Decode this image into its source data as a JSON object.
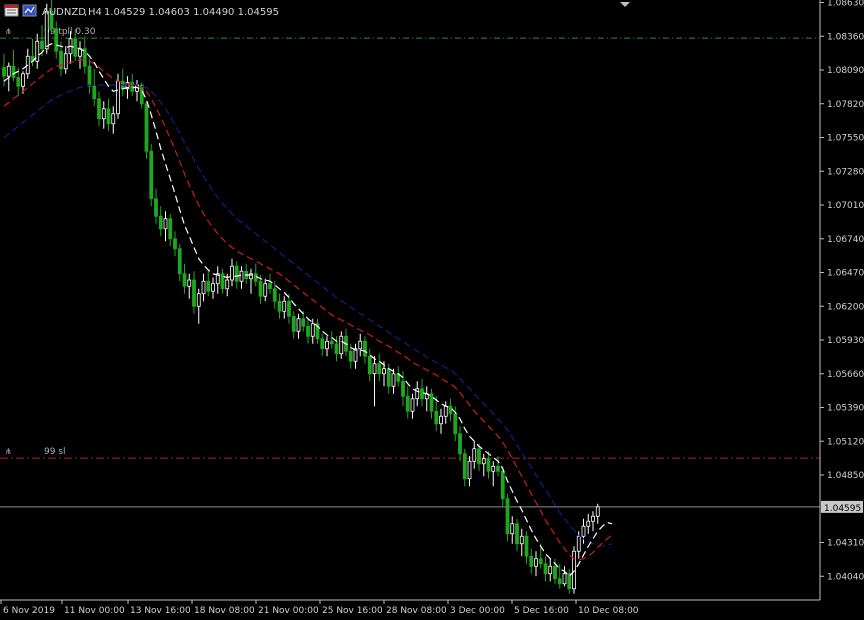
{
  "header": {
    "symbol": "AUDNZD",
    "timeframe": "H4",
    "ohlc_text": "1.04529 1.04603 1.04490 1.04595"
  },
  "colors": {
    "background": "#000000",
    "axis": "#c0c0c0",
    "text": "#d0d0d0",
    "bull_candle": "#ffffff",
    "bear_candle": "#1fa71f",
    "ma_fast": "#ffffff",
    "ma_mid": "#d01a1a",
    "ma_slow": "#1a1a8c",
    "tp_line": "#2e8b2e",
    "sl_line": "#c01a1a",
    "price_line": "#8a9099",
    "price_label_bg": "#c8c8c8",
    "price_label_text": "#000000"
  },
  "chart_data": {
    "type": "candlestick",
    "symbol": "AUDNZD",
    "timeframe": "H4",
    "ylim": [
      1.0385,
      1.0865
    ],
    "y_ticks": [
      "1.08630",
      "1.08360",
      "1.08090",
      "1.07820",
      "1.07550",
      "1.07280",
      "1.07010",
      "1.06740",
      "1.06470",
      "1.06200",
      "1.05930",
      "1.05660",
      "1.05390",
      "1.05120",
      "1.04850",
      "1.04310",
      "1.04040"
    ],
    "x_ticks": [
      "6 Nov 2019",
      "11 Nov 00:00",
      "13 Nov 16:00",
      "18 Nov 08:00",
      "21 Nov 00:00",
      "25 Nov 16:00",
      "28 Nov 08:00",
      "3 Dec 00:00",
      "5 Dec 16:00",
      "10 Dec 08:00"
    ],
    "current_price": 1.04595,
    "current_price_label": "1.04595",
    "levels": [
      {
        "label": "99 tpll 0.30",
        "price": 1.08345,
        "kind": "tp"
      },
      {
        "label": "99 sl",
        "price": 1.04985,
        "kind": "sl"
      }
    ],
    "candles": [
      [
        1.0811,
        1.0822,
        1.0796,
        1.0804
      ],
      [
        1.0804,
        1.0815,
        1.0792,
        1.0812
      ],
      [
        1.0812,
        1.0825,
        1.08,
        1.0803
      ],
      [
        1.0803,
        1.0811,
        1.0788,
        1.0796
      ],
      [
        1.0796,
        1.0808,
        1.079,
        1.0806
      ],
      [
        1.0806,
        1.0826,
        1.0802,
        1.082
      ],
      [
        1.082,
        1.0834,
        1.0812,
        1.0816
      ],
      [
        1.0816,
        1.0838,
        1.081,
        1.0832
      ],
      [
        1.0832,
        1.0845,
        1.082,
        1.0826
      ],
      [
        1.0826,
        1.0862,
        1.0822,
        1.0856
      ],
      [
        1.0856,
        1.0866,
        1.0838,
        1.0842
      ],
      [
        1.0842,
        1.0848,
        1.0818,
        1.0824
      ],
      [
        1.0824,
        1.0832,
        1.0804,
        1.081
      ],
      [
        1.081,
        1.0828,
        1.0806,
        1.0822
      ],
      [
        1.0822,
        1.084,
        1.0814,
        1.0834
      ],
      [
        1.0834,
        1.0842,
        1.0816,
        1.082
      ],
      [
        1.082,
        1.0832,
        1.081,
        1.0826
      ],
      [
        1.0826,
        1.0836,
        1.0806,
        1.0812
      ],
      [
        1.0812,
        1.0818,
        1.079,
        1.0796
      ],
      [
        1.0796,
        1.081,
        1.078,
        1.0786
      ],
      [
        1.0786,
        1.0792,
        1.0764,
        1.077
      ],
      [
        1.077,
        1.0784,
        1.0762,
        1.0778
      ],
      [
        1.0778,
        1.0786,
        1.076,
        1.0766
      ],
      [
        1.0766,
        1.078,
        1.0758,
        1.0774
      ],
      [
        1.0774,
        1.0806,
        1.077,
        1.08
      ],
      [
        1.08,
        1.081,
        1.0788,
        1.0794
      ],
      [
        1.0794,
        1.0804,
        1.0786,
        1.0799
      ],
      [
        1.0799,
        1.0806,
        1.0788,
        1.0792
      ],
      [
        1.0792,
        1.0801,
        1.0784,
        1.0797
      ],
      [
        1.0797,
        1.0799,
        1.0778,
        1.0782
      ],
      [
        1.0782,
        1.0784,
        1.0738,
        1.0744
      ],
      [
        1.0744,
        1.075,
        1.07,
        1.0706
      ],
      [
        1.0706,
        1.0714,
        1.0686,
        1.0692
      ],
      [
        1.0692,
        1.07,
        1.0676,
        1.0682
      ],
      [
        1.0682,
        1.0696,
        1.0672,
        1.069
      ],
      [
        1.069,
        1.0694,
        1.0668,
        1.0674
      ],
      [
        1.0674,
        1.068,
        1.066,
        1.0666
      ],
      [
        1.0666,
        1.067,
        1.064,
        1.0646
      ],
      [
        1.0646,
        1.0654,
        1.063,
        1.0636
      ],
      [
        1.0636,
        1.0646,
        1.0626,
        1.0641
      ],
      [
        1.0641,
        1.0648,
        1.0614,
        1.062
      ],
      [
        1.062,
        1.0634,
        1.0606,
        1.063
      ],
      [
        1.063,
        1.0646,
        1.0624,
        1.064
      ],
      [
        1.064,
        1.0648,
        1.0628,
        1.0632
      ],
      [
        1.0632,
        1.0643,
        1.0626,
        1.0638
      ],
      [
        1.0638,
        1.0652,
        1.063,
        1.0646
      ],
      [
        1.0646,
        1.065,
        1.063,
        1.0634
      ],
      [
        1.0634,
        1.0646,
        1.0628,
        1.0641
      ],
      [
        1.0641,
        1.0658,
        1.0636,
        1.0652
      ],
      [
        1.0652,
        1.0656,
        1.0634,
        1.064
      ],
      [
        1.064,
        1.0652,
        1.0634,
        1.0648
      ],
      [
        1.0648,
        1.0654,
        1.0638,
        1.0642
      ],
      [
        1.0642,
        1.065,
        1.063,
        1.0646
      ],
      [
        1.0646,
        1.0654,
        1.0636,
        1.064
      ],
      [
        1.064,
        1.0645,
        1.0622,
        1.0628
      ],
      [
        1.0628,
        1.0642,
        1.0624,
        1.0638
      ],
      [
        1.0638,
        1.0646,
        1.063,
        1.0634
      ],
      [
        1.0634,
        1.064,
        1.0618,
        1.0624
      ],
      [
        1.0624,
        1.063,
        1.061,
        1.0616
      ],
      [
        1.0616,
        1.0628,
        1.061,
        1.0624
      ],
      [
        1.0624,
        1.063,
        1.0606,
        1.0612
      ],
      [
        1.0612,
        1.0616,
        1.0594,
        1.06
      ],
      [
        1.06,
        1.0614,
        1.0594,
        1.061
      ],
      [
        1.061,
        1.0616,
        1.06,
        1.0604
      ],
      [
        1.0604,
        1.061,
        1.059,
        1.0596
      ],
      [
        1.0596,
        1.061,
        1.059,
        1.0606
      ],
      [
        1.0606,
        1.061,
        1.059,
        1.0594
      ],
      [
        1.0594,
        1.0598,
        1.058,
        1.0586
      ],
      [
        1.0586,
        1.0596,
        1.058,
        1.0592
      ],
      [
        1.0592,
        1.06,
        1.0586,
        1.059
      ],
      [
        1.059,
        1.0596,
        1.0576,
        1.0582
      ],
      [
        1.0582,
        1.06,
        1.0578,
        1.0596
      ],
      [
        1.0596,
        1.0602,
        1.058,
        1.0584
      ],
      [
        1.0584,
        1.059,
        1.057,
        1.0576
      ],
      [
        1.0576,
        1.059,
        1.057,
        1.0586
      ],
      [
        1.0586,
        1.0598,
        1.058,
        1.0592
      ],
      [
        1.0592,
        1.0596,
        1.0574,
        1.058
      ],
      [
        1.058,
        1.0586,
        1.056,
        1.0566
      ],
      [
        1.0566,
        1.058,
        1.054,
        1.0574
      ],
      [
        1.0574,
        1.0582,
        1.056,
        1.0566
      ],
      [
        1.0566,
        1.0576,
        1.0556,
        1.057
      ],
      [
        1.057,
        1.0574,
        1.055,
        1.0556
      ],
      [
        1.0556,
        1.057,
        1.055,
        1.0566
      ],
      [
        1.0566,
        1.0572,
        1.0556,
        1.056
      ],
      [
        1.056,
        1.0568,
        1.054,
        1.0548
      ],
      [
        1.0548,
        1.0556,
        1.053,
        1.0536
      ],
      [
        1.0536,
        1.055,
        1.053,
        1.0546
      ],
      [
        1.0546,
        1.056,
        1.054,
        1.0554
      ],
      [
        1.0554,
        1.0562,
        1.054,
        1.0546
      ],
      [
        1.0546,
        1.0556,
        1.0536,
        1.055
      ],
      [
        1.055,
        1.0554,
        1.053,
        1.0536
      ],
      [
        1.0536,
        1.0548,
        1.052,
        1.0526
      ],
      [
        1.0526,
        1.0538,
        1.0518,
        1.0532
      ],
      [
        1.0532,
        1.0544,
        1.0526,
        1.054
      ],
      [
        1.054,
        1.0546,
        1.0528,
        1.0534
      ],
      [
        1.0534,
        1.054,
        1.0512,
        1.0518
      ],
      [
        1.0518,
        1.0524,
        1.0496,
        1.0502
      ],
      [
        1.0502,
        1.0506,
        1.0476,
        1.0482
      ],
      [
        1.0482,
        1.05,
        1.0476,
        1.0496
      ],
      [
        1.0496,
        1.0512,
        1.049,
        1.0506
      ],
      [
        1.0506,
        1.051,
        1.0488,
        1.0494
      ],
      [
        1.0494,
        1.0502,
        1.0484,
        1.0498
      ],
      [
        1.0498,
        1.0504,
        1.0482,
        1.0488
      ],
      [
        1.0488,
        1.0496,
        1.0476,
        1.0492
      ],
      [
        1.0492,
        1.05,
        1.0484,
        1.0488
      ],
      [
        1.0488,
        1.0492,
        1.046,
        1.0466
      ],
      [
        1.0466,
        1.047,
        1.0432,
        1.0438
      ],
      [
        1.0438,
        1.0452,
        1.043,
        1.0446
      ],
      [
        1.0446,
        1.045,
        1.0424,
        1.043
      ],
      [
        1.043,
        1.0442,
        1.042,
        1.0436
      ],
      [
        1.0436,
        1.044,
        1.0414,
        1.042
      ],
      [
        1.042,
        1.0426,
        1.0406,
        1.0412
      ],
      [
        1.0412,
        1.0424,
        1.0404,
        1.0418
      ],
      [
        1.0418,
        1.043,
        1.041,
        1.0414
      ],
      [
        1.0414,
        1.042,
        1.04,
        1.0406
      ],
      [
        1.0406,
        1.0418,
        1.04,
        1.0412
      ],
      [
        1.0412,
        1.0418,
        1.0398,
        1.0402
      ],
      [
        1.0402,
        1.0414,
        1.0394,
        1.0398
      ],
      [
        1.0398,
        1.0412,
        1.0396,
        1.0406
      ],
      [
        1.0406,
        1.041,
        1.039,
        1.0394
      ],
      [
        1.0394,
        1.0428,
        1.039,
        1.0424
      ],
      [
        1.0424,
        1.044,
        1.0418,
        1.0436
      ],
      [
        1.0436,
        1.045,
        1.043,
        1.0444
      ],
      [
        1.0444,
        1.0454,
        1.0438,
        1.0448
      ],
      [
        1.0448,
        1.0456,
        1.044,
        1.0452
      ],
      [
        1.0452,
        1.0462,
        1.0446,
        1.04595
      ]
    ],
    "ma_fast": [
      1.08,
      1.0803,
      1.0806,
      1.0808,
      1.081,
      1.0813,
      1.0816,
      1.082,
      1.0823,
      1.0828,
      1.083,
      1.0829,
      1.0828,
      1.0827,
      1.0828,
      1.0827,
      1.0826,
      1.0824,
      1.082,
      1.0815,
      1.0808,
      1.0802,
      1.0796,
      1.0792,
      1.0793,
      1.0794,
      1.0795,
      1.0795,
      1.0795,
      1.0793,
      1.0785,
      1.0773,
      1.076,
      1.0746,
      1.0734,
      1.0722,
      1.071,
      1.0697,
      1.0685,
      1.0676,
      1.0667,
      1.0658,
      1.0653,
      1.0649,
      1.0646,
      1.0645,
      1.0644,
      1.0643,
      1.0644,
      1.0644,
      1.0645,
      1.0645,
      1.0645,
      1.0644,
      1.0642,
      1.0641,
      1.064,
      1.0637,
      1.0634,
      1.0631,
      1.0627,
      1.0622,
      1.0618,
      1.0614,
      1.061,
      1.0607,
      1.0604,
      1.06,
      1.0597,
      1.0595,
      1.0592,
      1.0592,
      1.059,
      1.0587,
      1.0585,
      1.0585,
      1.0584,
      1.0581,
      1.0578,
      1.0576,
      1.0573,
      1.057,
      1.0568,
      1.0566,
      1.0563,
      1.0558,
      1.0554,
      1.0552,
      1.0551,
      1.055,
      1.0548,
      1.0545,
      1.0542,
      1.054,
      1.0539,
      1.0535,
      1.053,
      1.0522,
      1.0516,
      1.0512,
      1.0508,
      1.0505,
      1.0502,
      1.0499,
      1.0496,
      1.049,
      1.048,
      1.0472,
      1.0464,
      1.0457,
      1.0449,
      1.0441,
      1.0434,
      1.0428,
      1.0422,
      1.0418,
      1.0414,
      1.041,
      1.0408,
      1.0404,
      1.0408,
      1.0414,
      1.0421,
      1.0428,
      1.0434,
      1.044,
      1.0444,
      1.0447,
      1.0446
    ],
    "ma_mid": [
      1.078,
      1.0783,
      1.0786,
      1.0789,
      1.0792,
      1.0795,
      1.0798,
      1.0801,
      1.0804,
      1.0807,
      1.081,
      1.0812,
      1.0813,
      1.0814,
      1.0815,
      1.0816,
      1.0817,
      1.0817,
      1.0816,
      1.0814,
      1.0811,
      1.0808,
      1.0805,
      1.0802,
      1.08,
      1.0799,
      1.0798,
      1.0797,
      1.0796,
      1.0795,
      1.0792,
      1.0786,
      1.0779,
      1.0771,
      1.0763,
      1.0754,
      1.0745,
      1.0736,
      1.0726,
      1.0717,
      1.0709,
      1.0701,
      1.0694,
      1.0688,
      1.0683,
      1.0678,
      1.0674,
      1.067,
      1.0667,
      1.0664,
      1.0662,
      1.066,
      1.0658,
      1.0656,
      1.0654,
      1.0652,
      1.065,
      1.0648,
      1.0646,
      1.0643,
      1.064,
      1.0637,
      1.0634,
      1.0631,
      1.0628,
      1.0625,
      1.0622,
      1.0619,
      1.0616,
      1.0613,
      1.0611,
      1.0609,
      1.0607,
      1.0605,
      1.0603,
      1.0601,
      1.0599,
      1.0597,
      1.0595,
      1.0592,
      1.059,
      1.0588,
      1.0586,
      1.0583,
      1.0581,
      1.0578,
      1.0575,
      1.0573,
      1.0571,
      1.0569,
      1.0567,
      1.0565,
      1.0562,
      1.056,
      1.0558,
      1.0555,
      1.0551,
      1.0546,
      1.0541,
      1.0536,
      1.0532,
      1.0528,
      1.0524,
      1.052,
      1.0516,
      1.0511,
      1.0505,
      1.0498,
      1.0491,
      1.0484,
      1.0477,
      1.047,
      1.0463,
      1.0456,
      1.0449,
      1.0443,
      1.0437,
      1.0431,
      1.0426,
      1.0421,
      1.0418,
      1.0417,
      1.0418,
      1.042,
      1.0423,
      1.0427,
      1.0431,
      1.0434,
      1.0437
    ],
    "ma_slow": [
      1.0755,
      1.0758,
      1.0761,
      1.0764,
      1.0767,
      1.077,
      1.0773,
      1.0776,
      1.0779,
      1.0782,
      1.0785,
      1.0787,
      1.0789,
      1.0791,
      1.0792,
      1.0794,
      1.0795,
      1.0796,
      1.0797,
      1.0797,
      1.0797,
      1.0797,
      1.0797,
      1.0797,
      1.0797,
      1.0797,
      1.0797,
      1.0797,
      1.0797,
      1.0796,
      1.0795,
      1.0792,
      1.0788,
      1.0783,
      1.0778,
      1.0772,
      1.0765,
      1.0758,
      1.0751,
      1.0744,
      1.0737,
      1.073,
      1.0724,
      1.0718,
      1.0712,
      1.0707,
      1.0702,
      1.0698,
      1.0694,
      1.069,
      1.0687,
      1.0684,
      1.0681,
      1.0678,
      1.0675,
      1.0672,
      1.0669,
      1.0666,
      1.0663,
      1.066,
      1.0657,
      1.0654,
      1.0651,
      1.0648,
      1.0645,
      1.0642,
      1.0639,
      1.0636,
      1.0633,
      1.063,
      1.0627,
      1.0624,
      1.0622,
      1.0619,
      1.0617,
      1.0614,
      1.0612,
      1.0609,
      1.0607,
      1.0604,
      1.0602,
      1.0599,
      1.0597,
      1.0594,
      1.0592,
      1.0589,
      1.0587,
      1.0584,
      1.0582,
      1.0579,
      1.0577,
      1.0575,
      1.0573,
      1.0571,
      1.0569,
      1.0566,
      1.0562,
      1.0558,
      1.0554,
      1.055,
      1.0546,
      1.0542,
      1.0538,
      1.0534,
      1.053,
      1.0526,
      1.0521,
      1.0515,
      1.0509,
      1.0503,
      1.0497,
      1.0491,
      1.0485,
      1.0479,
      1.0473,
      1.0467,
      1.0461,
      1.0455,
      1.045,
      1.0445,
      1.0441,
      1.0437,
      1.0434,
      1.0432,
      1.043,
      1.0429,
      1.0428,
      1.0429,
      1.043
    ]
  }
}
